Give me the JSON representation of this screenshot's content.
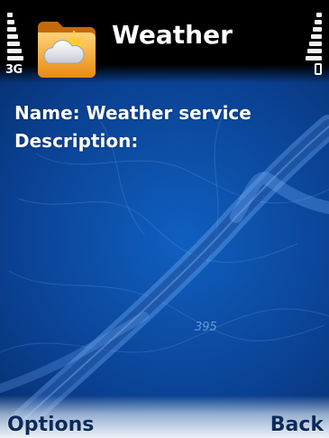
{
  "status": {
    "network_label": "3G"
  },
  "app": {
    "title": "Weather",
    "icon": "folder-weather-icon"
  },
  "details": {
    "name_label": "Name:",
    "name_value": "Weather service",
    "description_label": "Description:",
    "description_value": ""
  },
  "background": {
    "road_marker": "395"
  },
  "softkeys": {
    "left": "Options",
    "right": "Back"
  },
  "colors": {
    "accent_blue": "#0a3f8f",
    "softkey_text": "#0c2a5a"
  }
}
